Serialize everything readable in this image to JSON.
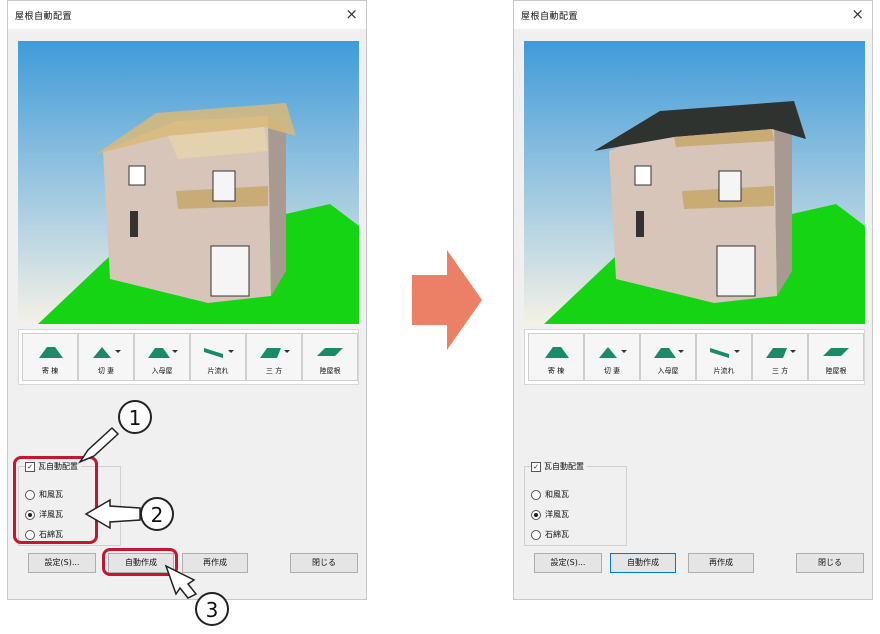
{
  "dialog": {
    "title": "屋根自動配置",
    "close_glyph": "×"
  },
  "toolbar": {
    "buttons": [
      {
        "label": "寄 棟",
        "icon": "hip-roof-icon"
      },
      {
        "label": "切 妻",
        "icon": "gable-roof-icon"
      },
      {
        "label": "入母屋",
        "icon": "irimoya-roof-icon"
      },
      {
        "label": "片流れ",
        "icon": "shed-roof-icon"
      },
      {
        "label": "三 方",
        "icon": "three-sided-roof-icon"
      },
      {
        "label": "陸屋根",
        "icon": "flat-roof-icon"
      }
    ]
  },
  "tile_options": {
    "checkbox_label": "瓦自動配置",
    "checkbox_checked": true,
    "radios": [
      {
        "label": "和風瓦",
        "selected": false
      },
      {
        "label": "洋風瓦",
        "selected": true
      },
      {
        "label": "石綿瓦",
        "selected": false
      }
    ]
  },
  "buttons": {
    "settings": "設定(S)...",
    "auto_create": "自動作成",
    "recreate": "再作成",
    "close": "閉じる"
  },
  "callouts": [
    "1",
    "2",
    "3"
  ],
  "colors": {
    "highlight": "#c4162e",
    "arrow": "#ec8066",
    "sky_top": "#3f9bd9",
    "ground": "#14d414",
    "roof_before": "#d9b87a",
    "roof_after": "#2f3330"
  }
}
